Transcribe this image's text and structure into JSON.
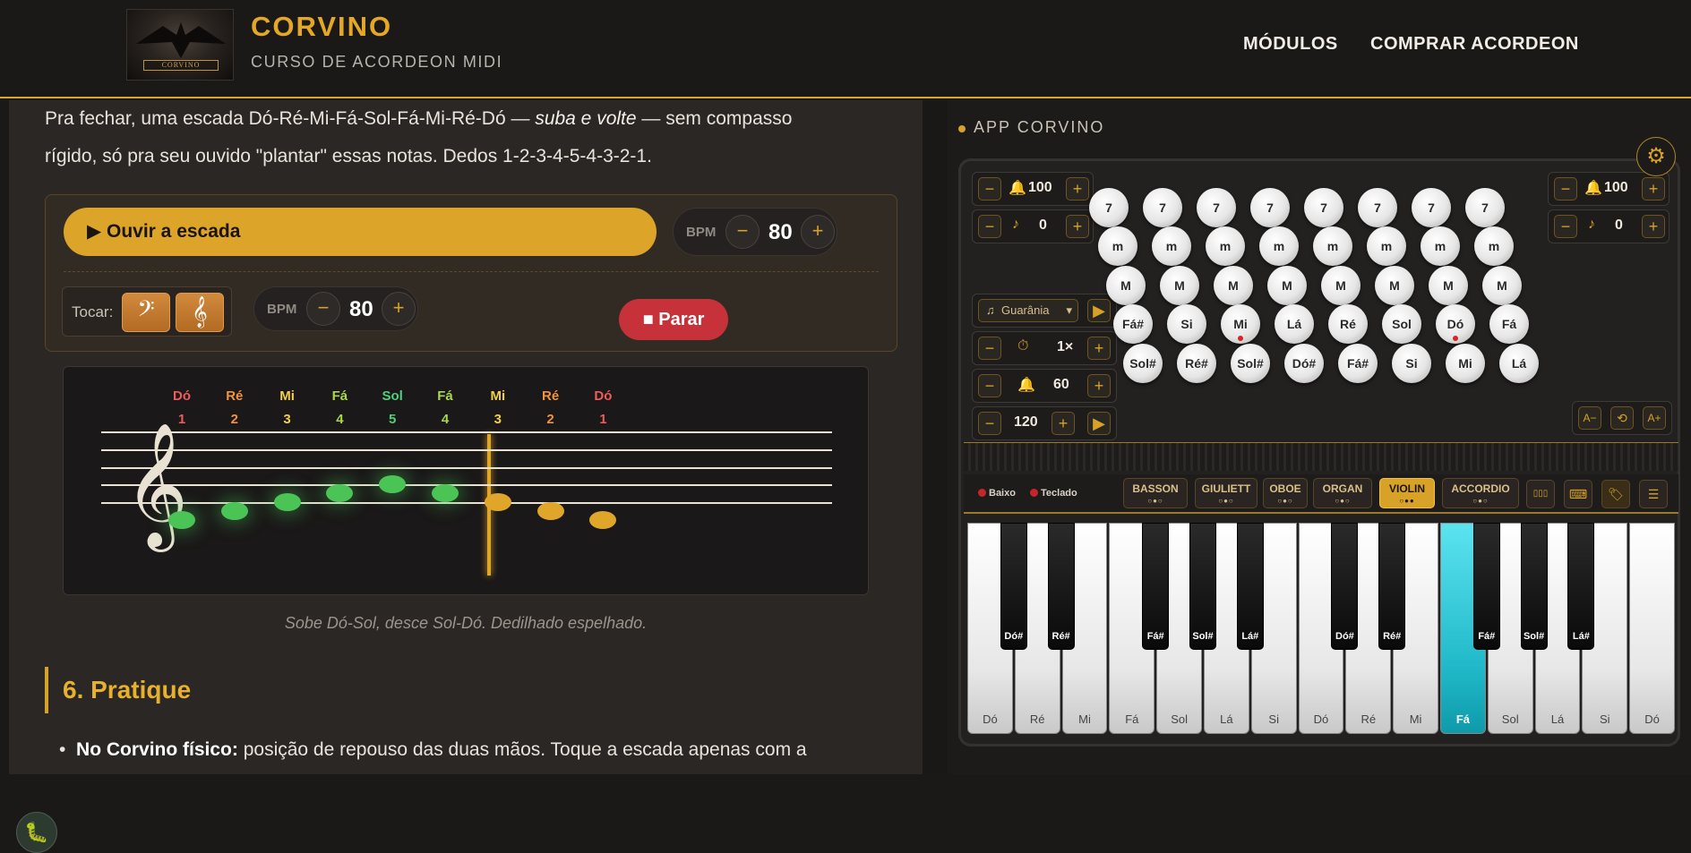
{
  "header": {
    "logo_text": "CORVINO",
    "brand": "CORVINO",
    "subtitle": "CURSO DE ACORDEON MIDI",
    "nav": [
      "MÓDULOS",
      "COMPRAR ACORDEON"
    ]
  },
  "lesson": {
    "intro_before": "Pra fechar, uma escada Dó-Ré-Mi-Fá-Sol-Fá-Mi-Ré-Dó — ",
    "intro_em": "suba e volte",
    "intro_after": " — sem compasso",
    "intro_line2": "rígido, só pra seu ouvido \"plantar\" essas notas. Dedos 1-2-3-4-5-4-3-2-1.",
    "player": {
      "play_label": "Ouvir a escada",
      "bpm_label": "BPM",
      "bpm_value": "80",
      "play_label_prefix": "▶",
      "tocar_label": "Tocar:",
      "bpm2_label": "BPM",
      "bpm2_value": "80",
      "stop_label": "Parar",
      "stop_prefix": "■",
      "minus": "−",
      "plus": "+"
    },
    "staff": {
      "note_names": [
        "Dó",
        "Ré",
        "Mi",
        "Fá",
        "Sol",
        "Fá",
        "Mi",
        "Ré",
        "Dó"
      ],
      "fingers": [
        "1",
        "2",
        "3",
        "4",
        "5",
        "4",
        "3",
        "2",
        "1"
      ],
      "name_colors": [
        "#f05b5b",
        "#f3923c",
        "#f2d048",
        "#a7d84b",
        "#4fd07a",
        "#a7d84b",
        "#f2d048",
        "#f3923c",
        "#f05b5b"
      ],
      "played_count": 6,
      "current_index": 6
    },
    "caption": "Sobe Dó-Sol, desce Sol-Dó. Dedilhado espelhado.",
    "section_title": "6. Pratique",
    "bullet_bold": "No Corvino físico:",
    "bullet_text": " posição de repouso das duas mãos. Toque a escada apenas com a"
  },
  "app": {
    "title": "APP CORVINO",
    "left_controls": {
      "vol": "100",
      "oct": "0",
      "rhythm": "Guarânia",
      "speed": "1×",
      "metro": "60",
      "tempo": "120"
    },
    "right_controls": {
      "vol": "100",
      "oct": "0"
    },
    "bass_rows": [
      [
        "7",
        "7",
        "7",
        "7",
        "7",
        "7",
        "7",
        "7"
      ],
      [
        "m",
        "m",
        "m",
        "m",
        "m",
        "m",
        "m",
        "m"
      ],
      [
        "M",
        "M",
        "M",
        "M",
        "M",
        "M",
        "M",
        "M"
      ],
      [
        "Fá#",
        "Si",
        "Mi",
        "Lá",
        "Ré",
        "Sol",
        "Dó",
        "Fá"
      ],
      [
        "Sol#",
        "Ré#",
        "Sol#",
        "Dó#",
        "Fá#",
        "Si",
        "Mi",
        "Lá"
      ]
    ],
    "marked_bass_notes": [
      "Mi",
      "Dó"
    ],
    "font_buttons": [
      "A−",
      "⟲",
      "A+"
    ],
    "indicators": [
      "Baixo",
      "Teclado"
    ],
    "registers": [
      {
        "label": "BASSON",
        "dots": "○●○"
      },
      {
        "label": "GIULIETT",
        "dots": "○●○"
      },
      {
        "label": "OBOE",
        "dots": "○●○"
      },
      {
        "label": "ORGAN",
        "dots": "○●○"
      },
      {
        "label": "VIOLIN",
        "dots": "○●●",
        "active": true
      },
      {
        "label": "ACCORDIO",
        "dots": "○●○"
      }
    ],
    "white_keys": [
      "Dó",
      "Ré",
      "Mi",
      "Fá",
      "Sol",
      "Lá",
      "Si",
      "Dó",
      "Ré",
      "Mi",
      "Fá",
      "Sol",
      "Lá",
      "Si",
      "Dó"
    ],
    "black_keys": [
      "Dó#",
      "Ré#",
      "Fá#",
      "Sol#",
      "Lá#",
      "Dó#",
      "Ré#",
      "Fá#",
      "Sol#",
      "Lá#"
    ],
    "active_white_key": "Fá"
  },
  "colors": {
    "accent": "#d7a227",
    "played_note": "#4ac455",
    "pending_note": "#e0a62a",
    "stop": "#c7323a",
    "active_key": "#1fb8c8"
  }
}
